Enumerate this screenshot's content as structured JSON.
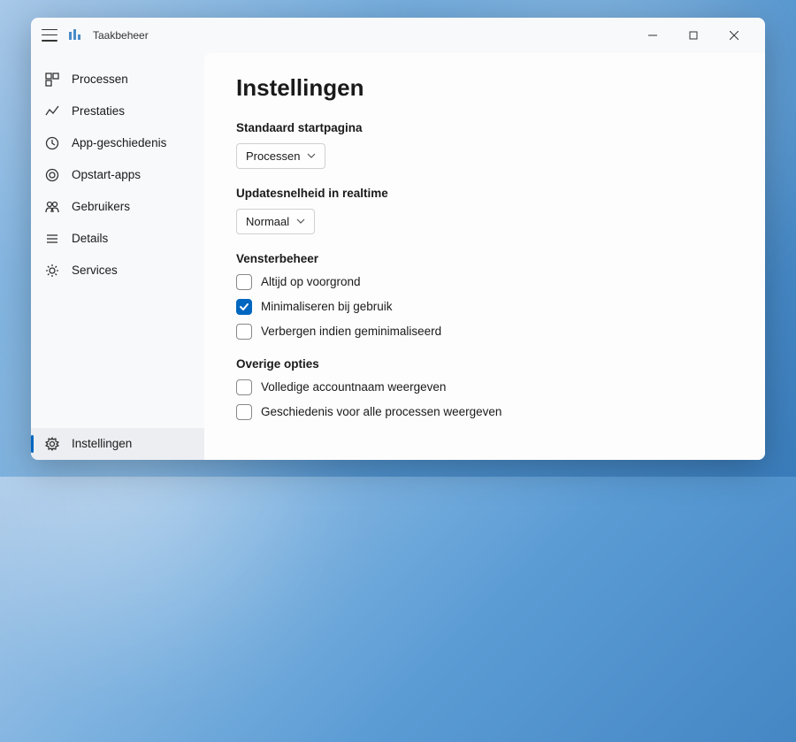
{
  "app": {
    "title": "Taakbeheer"
  },
  "sidebar": {
    "items": [
      {
        "label": "Processen"
      },
      {
        "label": "Prestaties"
      },
      {
        "label": "App-geschiedenis"
      },
      {
        "label": "Opstart-apps"
      },
      {
        "label": "Gebruikers"
      },
      {
        "label": "Details"
      },
      {
        "label": "Services"
      }
    ],
    "bottom": {
      "label": "Instellingen"
    }
  },
  "page": {
    "title": "Instellingen",
    "defaultPage": {
      "label": "Standaard startpagina",
      "value": "Processen"
    },
    "updateSpeed": {
      "label": "Updatesnelheid in realtime",
      "value": "Normaal"
    },
    "windowMgmt": {
      "label": "Vensterbeheer",
      "opts": [
        {
          "label": "Altijd op voorgrond",
          "checked": false
        },
        {
          "label": "Minimaliseren bij gebruik",
          "checked": true
        },
        {
          "label": "Verbergen indien geminimaliseerd",
          "checked": false
        }
      ]
    },
    "other": {
      "label": "Overige opties",
      "opts": [
        {
          "label": "Volledige accountnaam weergeven",
          "checked": false
        },
        {
          "label": "Geschiedenis voor alle processen weergeven",
          "checked": false
        }
      ]
    }
  }
}
